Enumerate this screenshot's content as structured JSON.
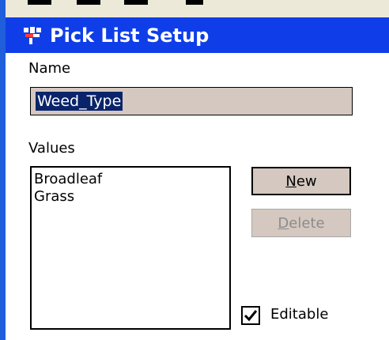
{
  "window": {
    "title": "Pick List Setup",
    "icon": "app-icon"
  },
  "name_section": {
    "label": "Name",
    "value": "Weed_Type"
  },
  "values_section": {
    "label": "Values",
    "items": [
      "Broadleaf",
      "Grass"
    ]
  },
  "buttons": {
    "new_label": "New",
    "delete_label": "Delete"
  },
  "editable": {
    "label": "Editable",
    "checked": true
  },
  "colors": {
    "titlebar": "#0f3ee8",
    "selection": "#0a246a",
    "field_bg": "#d4c8c0"
  }
}
